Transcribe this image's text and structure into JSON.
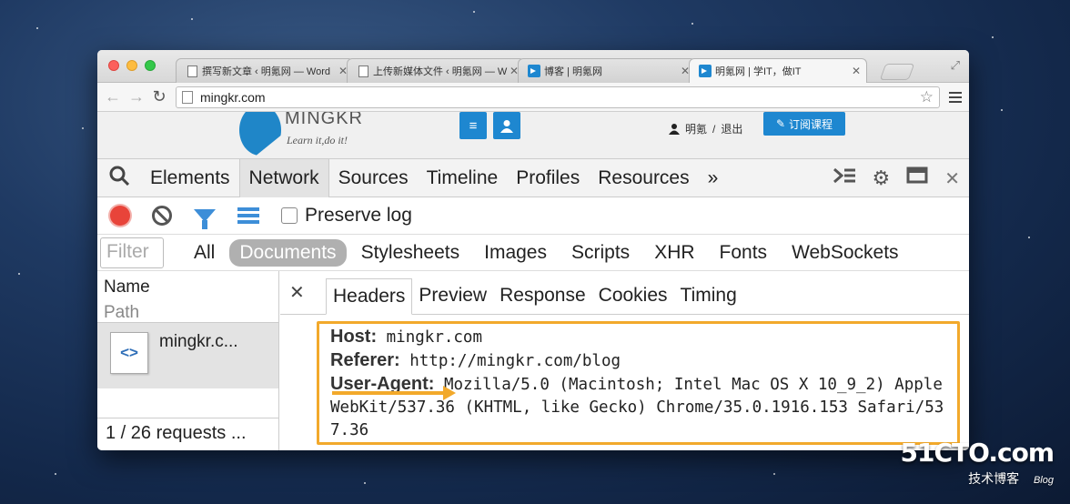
{
  "browser": {
    "tabs": [
      {
        "title": "撰写新文章 ‹ 明氪网 — Word",
        "active": false
      },
      {
        "title": "上传新媒体文件 ‹ 明氪网 — W",
        "active": false
      },
      {
        "title": "博客 | 明氪网",
        "active": false
      },
      {
        "title": "明氪网 | 学IT，做IT",
        "active": true
      }
    ],
    "url": "mingkr.com"
  },
  "site": {
    "logo_text": "MINGKR",
    "slogan": "Learn it,do it!",
    "user_name": "明氪",
    "logout": "退出",
    "separator": "/",
    "subscribe": "订阅课程"
  },
  "devtools": {
    "panels": [
      "Elements",
      "Network",
      "Sources",
      "Timeline",
      "Profiles",
      "Resources"
    ],
    "active_panel": "Network",
    "more": "»",
    "preserve_log": "Preserve log",
    "filter_placeholder": "Filter",
    "filter_types": [
      "All",
      "Documents",
      "Stylesheets",
      "Images",
      "Scripts",
      "XHR",
      "Fonts",
      "WebSockets"
    ],
    "active_filter": "Documents",
    "columns": {
      "name": "Name",
      "path": "Path"
    },
    "request": {
      "name": "mingkr.c..."
    },
    "status": "1 / 26 requests ...",
    "detail_tabs": [
      "Headers",
      "Preview",
      "Response",
      "Cookies",
      "Timing"
    ],
    "headers": [
      {
        "key": "Host:",
        "value": " mingkr.com"
      },
      {
        "key": "Referer:",
        "value": " http://mingkr.com/blog"
      },
      {
        "key": "User-Agent:",
        "value": " Mozilla/5.0 (Macintosh; Intel Mac OS X 10_9_2) AppleWebKit/537.36 (KHTML, like Gecko) Chrome/35.0.1916.153 Safari/537.36"
      }
    ]
  },
  "watermark": {
    "main": "51CTO.com",
    "sub": "技术博客",
    "blog": "Blog"
  },
  "colors": {
    "accent_blue": "#1e87d0",
    "highlight_orange": "#f2a92b",
    "record_red": "#e8443a"
  }
}
